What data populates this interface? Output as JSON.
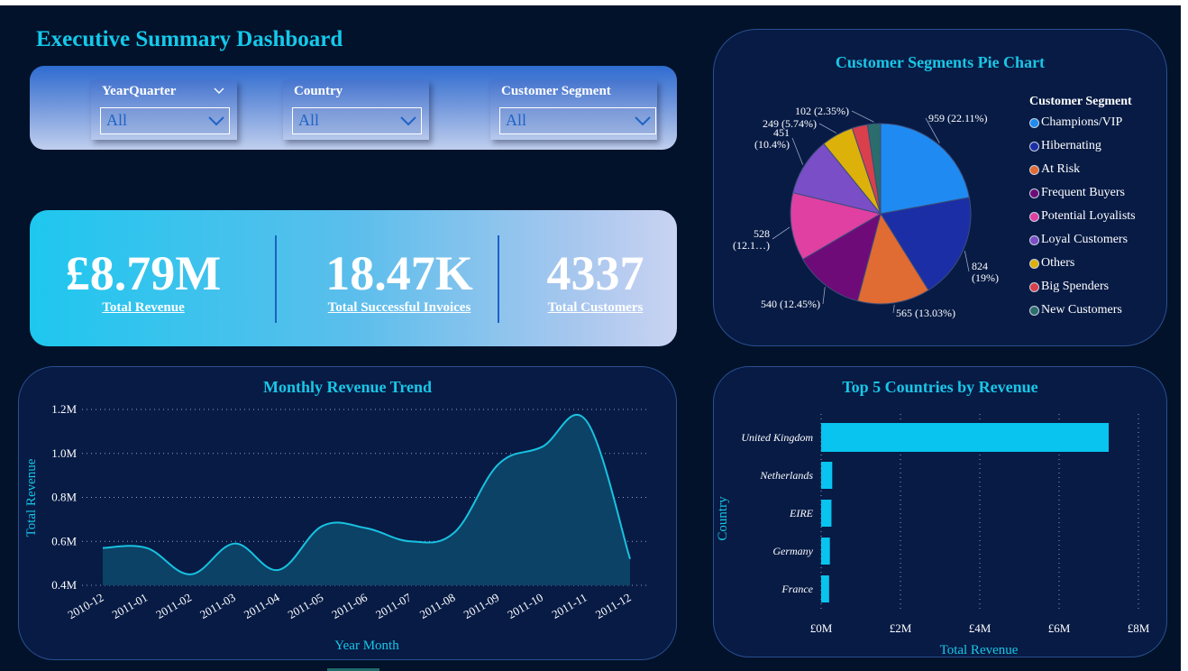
{
  "page": {
    "title": "Executive Summary Dashboard"
  },
  "filters": [
    {
      "label": "YearQuarter",
      "value": "All"
    },
    {
      "label": "Country",
      "value": "All"
    },
    {
      "label": "Customer Segment",
      "value": "All"
    }
  ],
  "kpis": [
    {
      "value": "£8.79M",
      "caption": "Total Revenue"
    },
    {
      "value": "18.47K",
      "caption": "Total Successful Invoices"
    },
    {
      "value": "4337",
      "caption": "Total Customers"
    }
  ],
  "chart_data": [
    {
      "type": "pie",
      "title": "Customer Segments Pie Chart",
      "legend_title": "Customer Segment",
      "legend_position": "right",
      "slices": [
        {
          "name": "Champions/VIP",
          "value": 959,
          "label": "959 (22.11%)",
          "color": "#1f8bf2"
        },
        {
          "name": "Hibernating",
          "value": 824,
          "label": "824\n(19%)",
          "color": "#1c2ea5"
        },
        {
          "name": "At Risk",
          "value": 565,
          "label": "565 (13.03%)",
          "color": "#e06b33"
        },
        {
          "name": "Frequent Buyers",
          "value": 540,
          "label": "540 (12.45%)",
          "color": "#6e0b79"
        },
        {
          "name": "Potential Loyalists",
          "value": 528,
          "label": "528\n(12.1…)",
          "color": "#df40a2"
        },
        {
          "name": "Loyal Customers",
          "value": 451,
          "label": "451\n(10.4%)",
          "color": "#7a4ec6"
        },
        {
          "name": "Others",
          "value": 249,
          "label": "249 (5.74%)",
          "color": "#dcb10a"
        },
        {
          "name": "Big Spenders",
          "value": 120,
          "label": "",
          "color": "#d9404b"
        },
        {
          "name": "New Customers",
          "value": 102,
          "label": "102 (2.35%)",
          "color": "#2b6d6c"
        }
      ]
    },
    {
      "type": "area",
      "title": "Monthly Revenue Trend",
      "xlabel": "Year Month",
      "ylabel": "Total Revenue",
      "categories": [
        "2010-12",
        "2011-01",
        "2011-02",
        "2011-03",
        "2011-04",
        "2011-05",
        "2011-06",
        "2011-07",
        "2011-08",
        "2011-09",
        "2011-10",
        "2011-11",
        "2011-12"
      ],
      "values": [
        0.57,
        0.57,
        0.45,
        0.59,
        0.47,
        0.67,
        0.66,
        0.6,
        0.64,
        0.95,
        1.03,
        1.15,
        0.52
      ],
      "ylim": [
        0.4,
        1.2
      ],
      "yticks": [
        "0.4M",
        "0.6M",
        "0.8M",
        "1.0M",
        "1.2M"
      ],
      "grid": "horizontal dotted",
      "color": "#18c2e0"
    },
    {
      "type": "bar",
      "orientation": "horizontal",
      "title": "Top 5 Countries by Revenue",
      "xlabel": "Total Revenue",
      "ylabel": "Country",
      "categories": [
        "United Kingdom",
        "Netherlands",
        "EIRE",
        "Germany",
        "France"
      ],
      "values": [
        7.25,
        0.28,
        0.26,
        0.22,
        0.2
      ],
      "xlim": [
        0,
        8
      ],
      "xticks": [
        "£0M",
        "£2M",
        "£4M",
        "£6M",
        "£8M"
      ],
      "grid": "vertical dotted",
      "color": "#08c4ee"
    }
  ]
}
